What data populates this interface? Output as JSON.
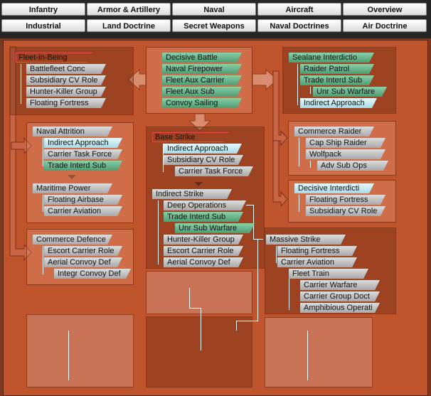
{
  "tabs": {
    "row1": [
      "Infantry",
      "Armor & Artillery",
      "Naval",
      "Aircraft",
      "Overview"
    ],
    "row2": [
      "Industrial",
      "Land Doctrine",
      "Secret Weapons",
      "Naval Doctrines",
      "Air Doctrine"
    ]
  },
  "center_top": [
    "Decisive Battle",
    "Naval Firepower",
    "Fleet Aux Carrier",
    "Fleet Aux Sub",
    "Convoy Sailing"
  ],
  "fleet_in_being": {
    "title": "Fleet-in-Being",
    "items": [
      "Battlefleet Conc",
      "Subsidiary CV Role",
      "Hunter-Killer Group",
      "Floating Fortress"
    ]
  },
  "sealane": {
    "title": "Sealane Interdictio",
    "items": [
      "Raider Patrol",
      "Trade Interd Sub",
      "Unr Sub Warfare",
      "Indirect Approach"
    ]
  },
  "naval_attrition": {
    "title": "Naval Attrition",
    "items": [
      "Indirect Approach",
      "Carrier Task Force",
      "Trade Interd Sub"
    ]
  },
  "maritime_power": {
    "title": "Maritime Power",
    "items": [
      "Floating Airbase",
      "Carrier Aviation"
    ]
  },
  "commerce_defence": {
    "title": "Commerce Defence",
    "items": [
      "Escort Carrier Role",
      "Aerial Convoy Def",
      "Integr Convoy Def"
    ]
  },
  "base_strike": {
    "title": "Base Strike",
    "items": [
      "Indirect Approach",
      "Subsidiary CV Role",
      "Carrier Task Force"
    ]
  },
  "indirect_strike": {
    "title": "Indirect Strike",
    "items": [
      "Deep Operations",
      "Trade Interd Sub",
      "Unr Sub Warfare",
      "Hunter-Killer Group",
      "Escort Carrier Role",
      "Aerial Convoy Def"
    ]
  },
  "commerce_raider": {
    "title": "Commerce Raider",
    "items": [
      "Cap Ship Raider",
      "Wolfpack",
      "Adv Sub Ops"
    ]
  },
  "decisive_interdict": {
    "title": "Decisive Interdicti",
    "items": [
      "Floating Fortress",
      "Subsidiary CV Role"
    ]
  },
  "massive_strike": {
    "title": "Massive Strike",
    "items": [
      "Floating Fortress",
      "Carrier Aviation",
      "Fleet Train",
      "Carrier Warfare",
      "Carrier Group Doct",
      "Amphibious Operati"
    ]
  }
}
